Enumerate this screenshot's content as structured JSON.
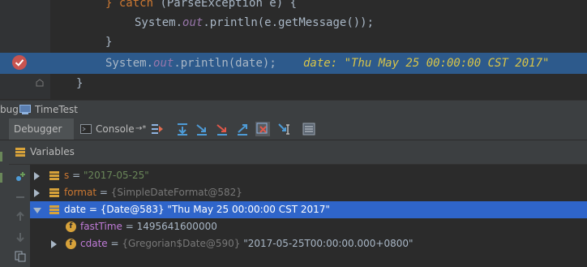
{
  "editor": {
    "lines": [
      {
        "kw1": "} catch ",
        "rest": "(ParseException e) {"
      },
      {
        "cls": "System.",
        "field": "out",
        "call": ".println(e.getMessage());"
      },
      {
        "brace": "}"
      },
      {
        "cls": "System.",
        "field": "out",
        "call": ".println(date);",
        "inline": "date: \"Thu May 25 00:00:00 CST 2017\""
      },
      {
        "brace": "}"
      }
    ]
  },
  "toolwindow": {
    "title_prefix": "bug",
    "config_name": "TimeTest"
  },
  "toolbar": {
    "tab_debugger": "Debugger",
    "tab_console": "Console",
    "console_suffix": "→*"
  },
  "variables": {
    "header": "Variables",
    "rows": [
      {
        "name": "s",
        "eq": " = ",
        "value": "\"2017-05-25\""
      },
      {
        "name": "format",
        "eq": " = ",
        "value": "{SimpleDateFormat@582}"
      },
      {
        "name": "date",
        "eq": " = ",
        "obj": "{Date@583}",
        "value": " \"Thu May 25 00:00:00 CST 2017\""
      },
      {
        "name": "fastTime",
        "eq": " = ",
        "value": "1495641600000"
      },
      {
        "name": "cdate",
        "eq": " = ",
        "obj": "{Gregorian$Date@590}",
        "value": " \"2017-05-25T00:00:00.000+0800\""
      }
    ]
  }
}
